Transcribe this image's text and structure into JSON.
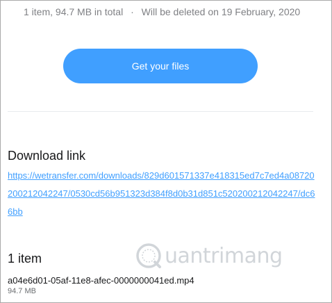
{
  "transfer": {
    "summary": "1 item, 94.7 MB in total",
    "separator": "·",
    "deletion_notice": "Will be deleted on 19 February, 2020",
    "cta_label": "Get your files"
  },
  "download": {
    "title": "Download link",
    "url": "https://wetransfer.com/downloads/829d601571337e418315ed7c7ed4a08720200212042247/0530cd56b951323d384f8d0b31d851c520200212042247/dc66bb"
  },
  "items": {
    "title": "1 item",
    "files": [
      {
        "name": "a04e6d01-05af-11e8-afec-0000000041ed.mp4",
        "size": "94.7 MB"
      }
    ]
  },
  "watermark": {
    "text": "uantrimang",
    "logo": "quantrimang-logo-icon"
  },
  "colors": {
    "accent": "#409fff",
    "muted_text": "#7f8084",
    "divider": "#e8ebed",
    "text": "#17181a"
  }
}
